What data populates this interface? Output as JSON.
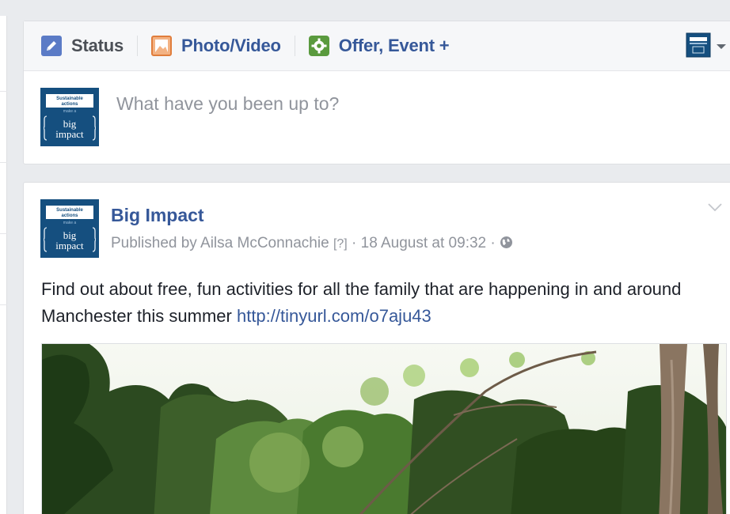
{
  "composer": {
    "tabs": [
      {
        "label": "Status"
      },
      {
        "label": "Photo/Video"
      },
      {
        "label": "Offer, Event +"
      }
    ],
    "placeholder": "What have you been up to?"
  },
  "avatar": {
    "line1": "Sustainable",
    "line2": "actions",
    "line3": "make a",
    "line4": "big",
    "line5": "impact"
  },
  "post": {
    "page_name": "Big Impact",
    "published_by": "Published by Ailsa McConnachie",
    "help_marker": "[?]",
    "meta_sep1": " · ",
    "timestamp": "18 August at 09:32",
    "meta_sep2": " · ",
    "text": "Find out about free, fun activities for all the family that are happening in and around Manchester this summer ",
    "link": "http://tinyurl.com/o7aju43"
  },
  "colors": {
    "link_blue": "#365899",
    "brand_navy": "#154f7f",
    "page_bg": "#e9ebee"
  },
  "icons": {
    "status": "pencil-icon",
    "photo": "photo-icon",
    "offer": "gear-icon",
    "privacy": "globe-icon",
    "menu": "chevron-down-icon"
  }
}
